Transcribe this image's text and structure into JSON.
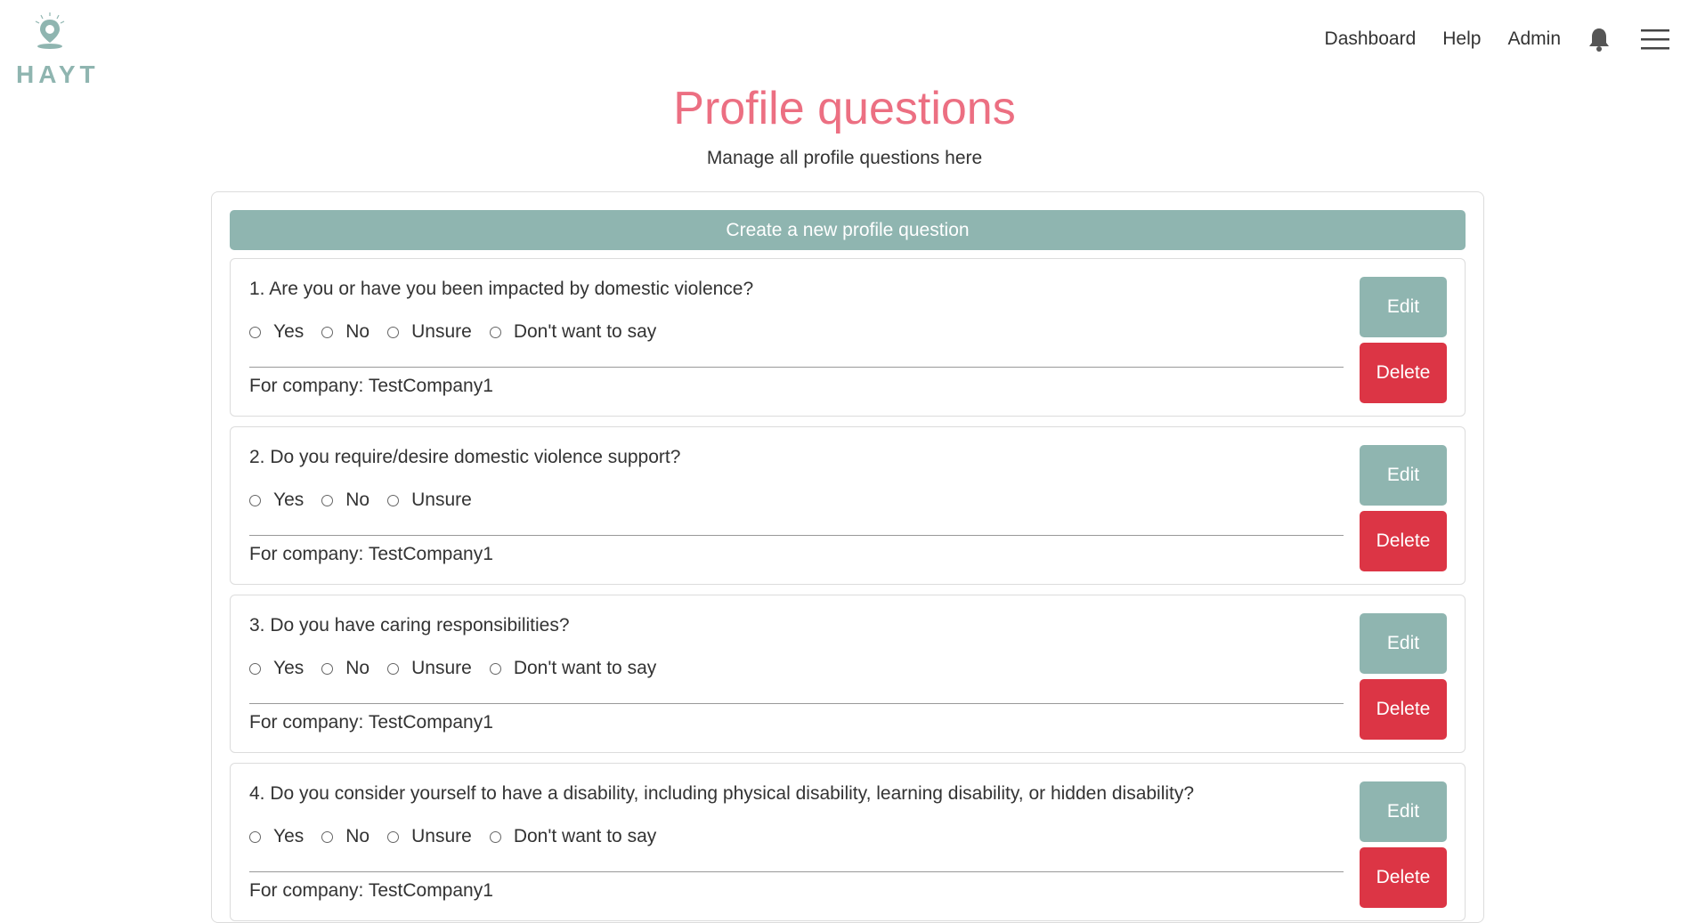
{
  "brand": {
    "logo_text": "HAYT"
  },
  "nav": {
    "dashboard": "Dashboard",
    "help": "Help",
    "admin": "Admin",
    "bell_icon": "bell-icon",
    "menu_icon": "hamburger-menu-icon"
  },
  "header": {
    "title": "Profile questions",
    "subtitle": "Manage all profile questions here"
  },
  "create_button": "Create a new profile question",
  "colors": {
    "accent": "#8fb5b0",
    "title": "#ec6f82",
    "danger": "#dc3545"
  },
  "questions": [
    {
      "text": "1. Are you or have you been impacted by domestic violence?",
      "options": [
        "Yes",
        "No",
        "Unsure",
        "Don't want to say"
      ],
      "company": "For company: TestCompany1",
      "edit": "Edit",
      "delete": "Delete"
    },
    {
      "text": "2. Do you require/desire domestic violence support?",
      "options": [
        "Yes",
        "No",
        "Unsure"
      ],
      "company": "For company: TestCompany1",
      "edit": "Edit",
      "delete": "Delete"
    },
    {
      "text": "3. Do you have caring responsibilities?",
      "options": [
        "Yes",
        "No",
        "Unsure",
        "Don't want to say"
      ],
      "company": "For company: TestCompany1",
      "edit": "Edit",
      "delete": "Delete"
    },
    {
      "text": "4. Do you consider yourself to have a disability, including physical disability, learning disability, or hidden disability?",
      "options": [
        "Yes",
        "No",
        "Unsure",
        "Don't want to say"
      ],
      "company": "For company: TestCompany1",
      "edit": "Edit",
      "delete": "Delete"
    }
  ]
}
